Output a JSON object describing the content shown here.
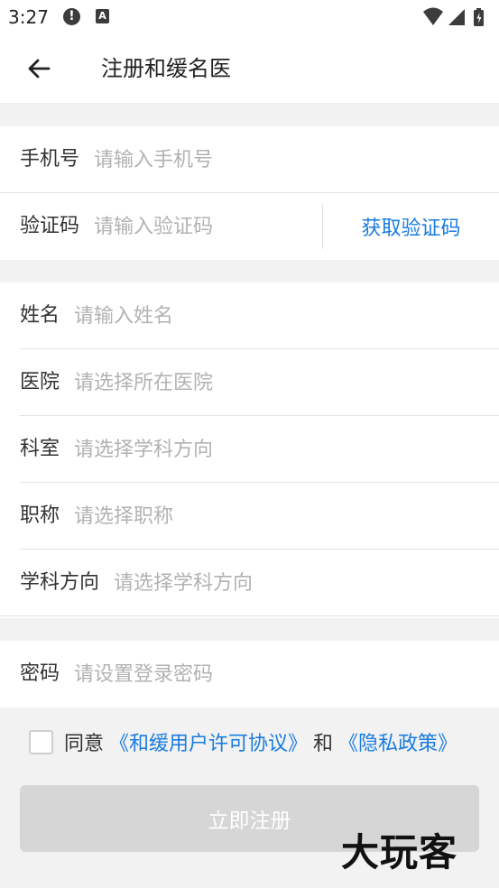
{
  "status_bar": {
    "time": "3:27",
    "alert_glyph": "!",
    "app_glyph": "A"
  },
  "header": {
    "title": "注册和缓名医",
    "back_icon": "arrow-left-icon"
  },
  "account_section": {
    "phone": {
      "label": "手机号",
      "placeholder": "请输入手机号",
      "value": ""
    },
    "code": {
      "label": "验证码",
      "placeholder": "请输入验证码",
      "value": "",
      "action_label": "获取验证码"
    }
  },
  "profile_section": {
    "name": {
      "label": "姓名",
      "placeholder": "请输入姓名"
    },
    "hospital": {
      "label": "医院",
      "placeholder": "请选择所在医院"
    },
    "department": {
      "label": "科室",
      "placeholder": "请选择学科方向"
    },
    "title": {
      "label": "职称",
      "placeholder": "请选择职称"
    },
    "discipline": {
      "label": "学科方向",
      "placeholder": "请选择学科方向"
    }
  },
  "password_section": {
    "password": {
      "label": "密码",
      "placeholder": "请设置登录密码"
    }
  },
  "agreement": {
    "checked": false,
    "prefix": "同意",
    "user_agreement": "《和缓用户许可协议》",
    "conjunction": "和",
    "privacy_policy": "《隐私政策》"
  },
  "submit": {
    "label": "立即注册"
  },
  "watermark": {
    "text": "大玩客"
  },
  "colors": {
    "accent": "#1a7ce0",
    "placeholder": "#b2b2b2",
    "disabled_button": "#d6d6d6",
    "page_background": "#f2f2f2"
  }
}
